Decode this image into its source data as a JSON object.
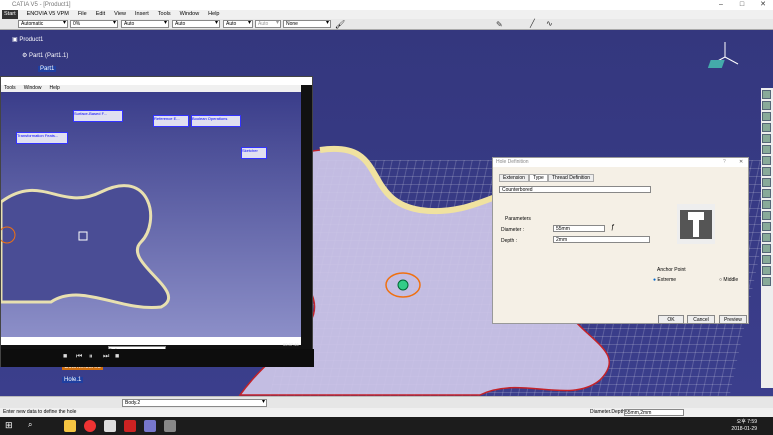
{
  "window": {
    "title": "CATIA V5 - [Product1]"
  },
  "menu": [
    "Start",
    "ENOVIA V5 VPM",
    "File",
    "Edit",
    "View",
    "Insert",
    "Tools",
    "Window",
    "Help"
  ],
  "toolbar": {
    "combos": [
      "Automatic",
      "0%",
      "Auto",
      "Auto",
      "Auto",
      "Auto",
      "None"
    ]
  },
  "tree": {
    "root": "Product1",
    "part": "Part1 (Part1.1)",
    "part_short": "Part1",
    "hole": "Hole.1",
    "counterbored": "Counterbored"
  },
  "video": {
    "menu": [
      "Tools",
      "Window",
      "Help"
    ],
    "tb_titles": [
      "Surface-Based F...",
      "Reference E...",
      "Boolean Operations",
      "Transformation Feats...",
      "Sketcher"
    ],
    "surfaces_label": "Surfaces",
    "time": "00:37:46"
  },
  "hole_dialog": {
    "title": "Hole Definition",
    "tabs": [
      "Extension",
      "Type",
      "Thread Definition"
    ],
    "type_value": "Counterbored",
    "parameters_label": "Parameters",
    "diameter_label": "Diameter :",
    "diameter_value": "55mm",
    "depth_label": "Depth :",
    "depth_value": "2mm",
    "anchor_label": "Anchor Point",
    "anchor_options": [
      "Extreme",
      "Middle"
    ],
    "ok": "OK",
    "cancel": "Cancel",
    "preview": "Preview"
  },
  "bottombar": {
    "body": "Body.2"
  },
  "status": {
    "message": "Enter new data to define the hole",
    "right": "Diameter.Depth",
    "right_value": "55mm,2mm"
  },
  "taskbar": {
    "time": "오후 7:59",
    "date": "2018-01-29"
  }
}
